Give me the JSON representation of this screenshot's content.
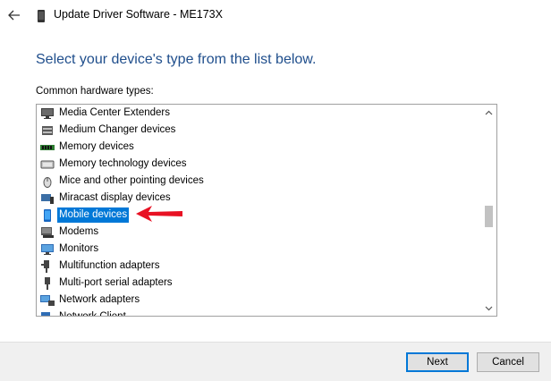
{
  "window": {
    "title": "Update Driver Software - ME173X"
  },
  "heading": "Select your device's type from the list below.",
  "list_label": "Common hardware types:",
  "devices": [
    {
      "label": "Media Center Extenders",
      "icon": "media-center-icon",
      "selected": false
    },
    {
      "label": "Medium Changer devices",
      "icon": "medium-changer-icon",
      "selected": false
    },
    {
      "label": "Memory devices",
      "icon": "memory-icon",
      "selected": false
    },
    {
      "label": "Memory technology devices",
      "icon": "memory-technology-icon",
      "selected": false
    },
    {
      "label": "Mice and other pointing devices",
      "icon": "mouse-icon",
      "selected": false
    },
    {
      "label": "Miracast display devices",
      "icon": "miracast-icon",
      "selected": false
    },
    {
      "label": "Mobile devices",
      "icon": "mobile-device-icon",
      "selected": true
    },
    {
      "label": "Modems",
      "icon": "modem-icon",
      "selected": false
    },
    {
      "label": "Monitors",
      "icon": "monitor-icon",
      "selected": false
    },
    {
      "label": "Multifunction adapters",
      "icon": "multifunction-adapter-icon",
      "selected": false
    },
    {
      "label": "Multi-port serial adapters",
      "icon": "serial-adapter-icon",
      "selected": false
    },
    {
      "label": "Network adapters",
      "icon": "network-adapter-icon",
      "selected": false
    },
    {
      "label": "Network Client",
      "icon": "network-client-icon",
      "selected": false
    }
  ],
  "buttons": {
    "next": "Next",
    "cancel": "Cancel"
  },
  "colors": {
    "heading": "#1f4e8c",
    "selection": "#0078d7",
    "annotation_arrow": "#e81123"
  }
}
